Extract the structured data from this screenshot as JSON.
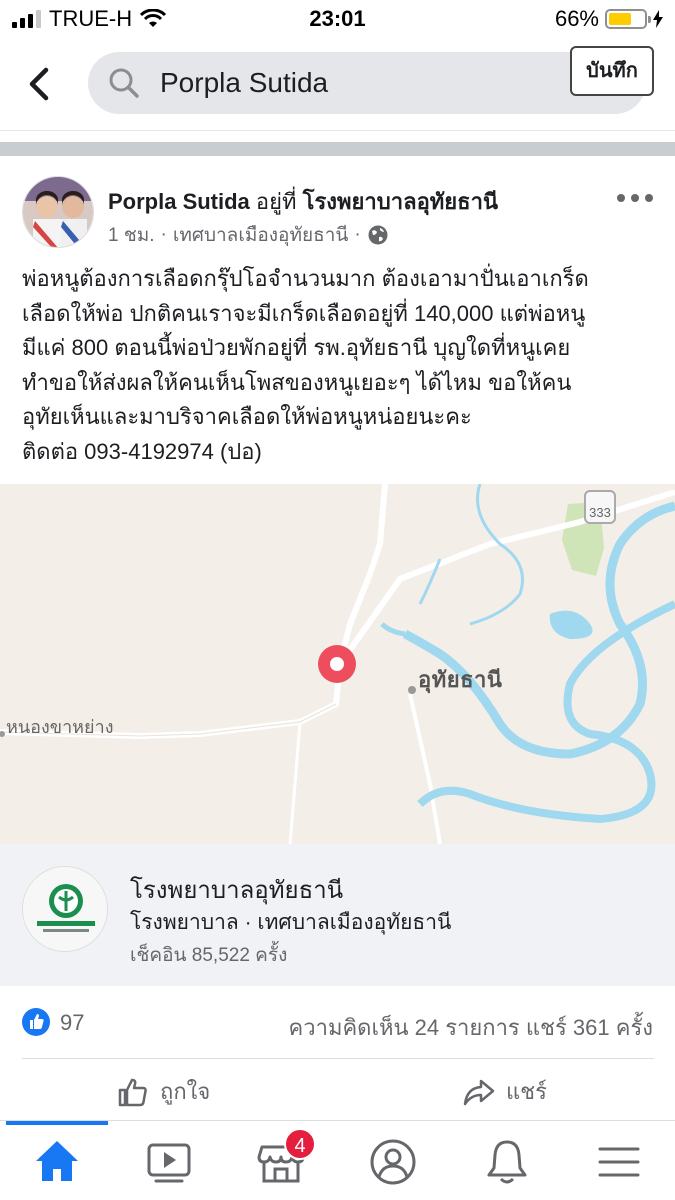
{
  "status_bar": {
    "carrier": "TRUE-H",
    "time": "23:01",
    "battery_percent": "66%",
    "battery_level": 0.66
  },
  "search": {
    "query": "Porpla Sutida"
  },
  "post": {
    "author": "Porpla Sutida",
    "location_prefix": "อยู่ที่",
    "location": "โรงพยาบาลอุทัยธานี",
    "time": "1 ชม.",
    "place": "เทศบาลเมืองอุทัยธานี",
    "separator": "·",
    "body_lines": [
      "พ่อหนูต้องการเลือดกรุ๊ปโอจำนวนมาก ต้องเอามาปั่นเอาเกร็ด",
      "เลือดให้พ่อ ปกติคนเราจะมีเกร็ดเลือดอยู่ที่ 140,000 แต่พ่อหนู",
      "มีแค่ 800 ตอนนี้พ่อป่วยพักอยู่ที่ รพ.อุทัยธานี บุญใดที่หนูเคย",
      "ทำขอให้ส่งผลให้คนเห็นโพสของหนูเยอะๆ ได้ไหม ขอให้คน",
      "อุทัยเห็นและมาบริจาคเลือดให้พ่อหนูหน่อยนะคะ",
      "ติดต่อ 093-4192974 (ปอ)"
    ]
  },
  "map": {
    "city_label": "อุทัยธานี",
    "town_label": "หนองขาหย่าง",
    "route_number": "333"
  },
  "place_card": {
    "name": "โรงพยาบาลอุทัยธานี",
    "subtitle": "โรงพยาบาล · เทศบาลเมืองอุทัยธานี",
    "checkins": "เช็คอิน 85,522 ครั้ง",
    "save_label": "บันทึก"
  },
  "engagement": {
    "likes": "97",
    "comments_shares": "ความคิดเห็น 24 รายการ  แชร์ 361 ครั้ง"
  },
  "actions": {
    "like_label": "ถูกใจ",
    "share_label": "แชร์"
  },
  "tabbar": {
    "marketplace_badge": "4",
    "active_color": "#1877f2"
  }
}
